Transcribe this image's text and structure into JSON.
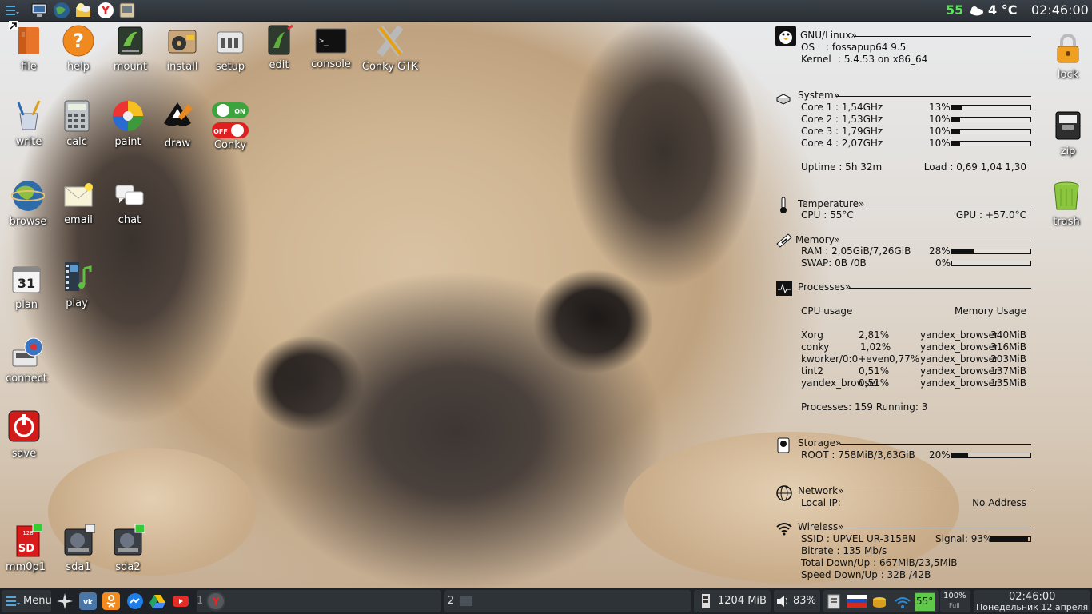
{
  "colors": {
    "topbar": "#2f343a",
    "accent_green": "#5ce35c",
    "taskbar": "#1f2327"
  },
  "topbar": {
    "left_icons": [
      "menu-icon",
      "monitor-icon",
      "globe-icon",
      "weather-folder-icon",
      "yandex-icon",
      "image-viewer-icon"
    ],
    "load_value": "55",
    "weather_icon": "cloud-sun-icon",
    "temperature": "4 °C",
    "time": "02:46:00"
  },
  "desktop": {
    "icons": [
      {
        "id": "file",
        "label": "file",
        "icon": "folder-icon"
      },
      {
        "id": "help",
        "label": "help",
        "icon": "help-icon"
      },
      {
        "id": "mount",
        "label": "mount",
        "icon": "drive-icon"
      },
      {
        "id": "install",
        "label": "install",
        "icon": "package-icon"
      },
      {
        "id": "setup",
        "label": "setup",
        "icon": "setup-icon"
      },
      {
        "id": "edit",
        "label": "edit",
        "icon": "notepad-icon"
      },
      {
        "id": "console",
        "label": "console",
        "icon": "terminal-icon"
      },
      {
        "id": "conkygtk",
        "label": "Conky GTK",
        "icon": "x-logo-icon"
      },
      {
        "id": "write",
        "label": "write",
        "icon": "pencil-cup-icon"
      },
      {
        "id": "calc",
        "label": "calc",
        "icon": "calculator-icon"
      },
      {
        "id": "paint",
        "label": "paint",
        "icon": "color-wheel-icon"
      },
      {
        "id": "draw",
        "label": "draw",
        "icon": "inkscape-icon"
      },
      {
        "id": "conky",
        "label": "Conky",
        "icon": "toggle-icon",
        "toggle_on": "ON",
        "toggle_off": "OFF"
      },
      {
        "id": "browse",
        "label": "browse",
        "icon": "globe-icon"
      },
      {
        "id": "email",
        "label": "email",
        "icon": "envelope-icon"
      },
      {
        "id": "chat",
        "label": "chat",
        "icon": "chat-icon"
      },
      {
        "id": "plan",
        "label": "plan",
        "icon": "calendar-icon",
        "day": "31"
      },
      {
        "id": "play",
        "label": "play",
        "icon": "film-music-icon"
      },
      {
        "id": "connect",
        "label": "connect",
        "icon": "network-icon"
      },
      {
        "id": "save",
        "label": "save",
        "icon": "power-icon"
      },
      {
        "id": "mm0p1",
        "label": "mm0p1",
        "icon": "sd-card-icon",
        "sd_size": "128",
        "sd_text": "SD"
      },
      {
        "id": "sda1",
        "label": "sda1",
        "icon": "hdd-icon"
      },
      {
        "id": "sda2",
        "label": "sda2",
        "icon": "hdd-icon"
      },
      {
        "id": "lock",
        "label": "lock",
        "icon": "padlock-icon"
      },
      {
        "id": "zip",
        "label": "zip",
        "icon": "archive-icon"
      },
      {
        "id": "trash",
        "label": "trash",
        "icon": "trash-icon"
      }
    ]
  },
  "conky": {
    "gnu": {
      "title": "GNU/Linux»",
      "os_label": "OS",
      "os_value": ": fossapup64 9.5",
      "kernel_label": "Kernel",
      "kernel_value": ": 5.4.53 on x86_64"
    },
    "system": {
      "title": "System»",
      "cores": [
        {
          "label": "Core 1 : 1,54GHz",
          "pct": "13%",
          "value": 13
        },
        {
          "label": "Core 2 : 1,53GHz",
          "pct": "10%",
          "value": 10
        },
        {
          "label": "Core 3 : 1,79GHz",
          "pct": "10%",
          "value": 10
        },
        {
          "label": "Core 4 : 2,07GHz",
          "pct": "10%",
          "value": 10
        }
      ],
      "uptime": "Uptime : 5h 32m",
      "load": "Load  : 0,69 1,04 1,30"
    },
    "temperature": {
      "title": "Temperature»",
      "cpu": "CPU : 55°C",
      "gpu": "GPU : +57.0°C"
    },
    "memory": {
      "title": "Memory»",
      "ram": "RAM : 2,05GiB/7,26GiB",
      "ram_pct": "28%",
      "ram_value": 28,
      "swap": "SWAP: 0B  /0B",
      "swap_pct": "0%",
      "swap_value": 0
    },
    "processes": {
      "title": "Processes»",
      "cpu_header": "CPU usage",
      "mem_header": "Memory Usage",
      "cpu_rows": [
        {
          "name": "Xorg",
          "value": "2,81%"
        },
        {
          "name": "conky",
          "value": "1,02%"
        },
        {
          "name": "kworker/0:0+even",
          "value": "0,77%"
        },
        {
          "name": "tint2",
          "value": "0,51%"
        },
        {
          "name": "yandex_browser",
          "value": "0,51%"
        }
      ],
      "mem_rows": [
        {
          "name": "yandex_browser",
          "value": "340MiB"
        },
        {
          "name": "yandex_browser",
          "value": "316MiB"
        },
        {
          "name": "yandex_browser",
          "value": "203MiB"
        },
        {
          "name": "yandex_browser",
          "value": "137MiB"
        },
        {
          "name": "yandex_browser",
          "value": "135MiB"
        }
      ],
      "summary": "Processes: 159 Running: 3"
    },
    "storage": {
      "title": "Storage»",
      "root": "ROOT : 758MiB/3,63GiB",
      "root_pct": "20%",
      "root_value": 20
    },
    "network": {
      "title": "Network»",
      "local_ip_label": "Local IP:",
      "local_ip_value": "No Address"
    },
    "wireless": {
      "title": "Wireless»",
      "ssid": "SSID        : UPVEL UR-315BN",
      "signal": "Signal: 93%",
      "signal_value": 93,
      "bitrate": "Bitrate       : 135 Mb/s",
      "total": "Total Down/Up : 667MiB/23,5MiB",
      "speed": "Speed Down/Up : 32B  /42B"
    }
  },
  "taskbar": {
    "menu_label": "Menu",
    "launchers": [
      "star-icon",
      "vk-icon",
      "odnoklassniki-icon",
      "messenger-icon",
      "drive-icon",
      "youtube-icon"
    ],
    "desktop1": "1",
    "desktop2": "2",
    "memory": "1204 MiB",
    "volume": "83%",
    "cpu_temp": "55°",
    "battery_pct": "100%",
    "battery_state": "Full",
    "clock_time": "02:46:00",
    "clock_date": "Понедельник 12 апреля"
  }
}
